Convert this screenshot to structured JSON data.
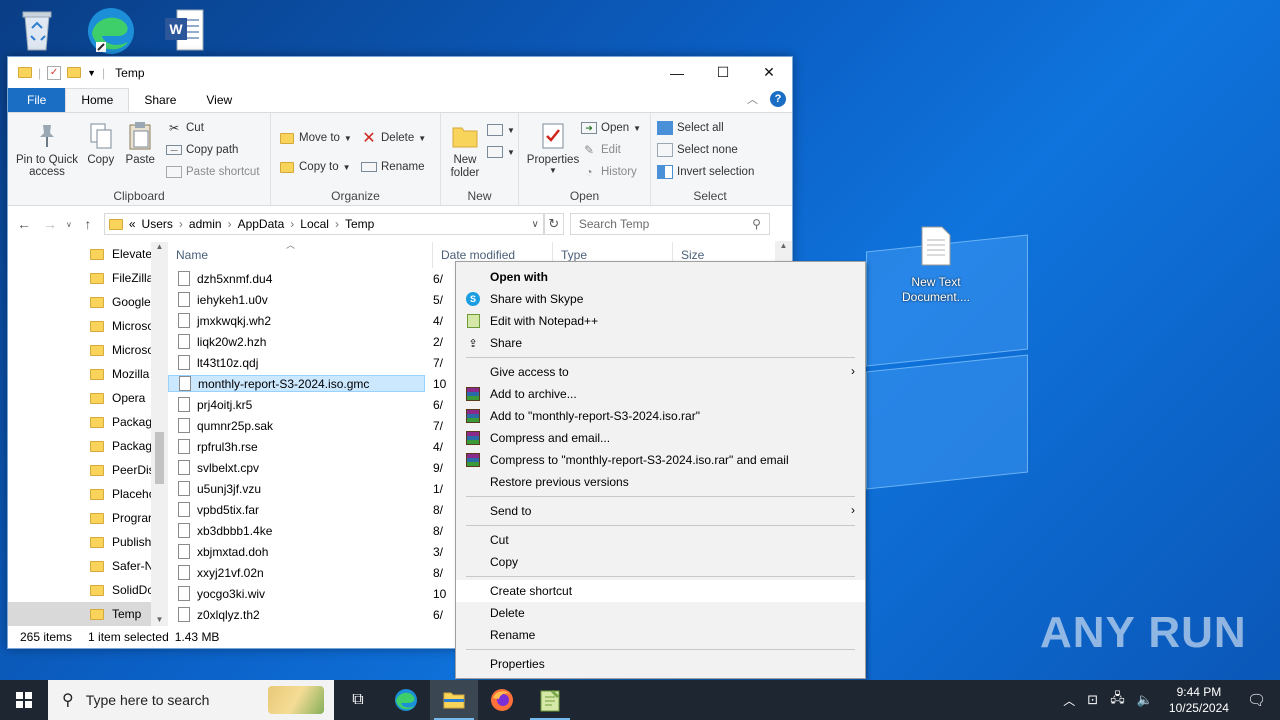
{
  "desktop": {
    "icons": [
      {
        "name": "recycle-bin",
        "label": ""
      },
      {
        "name": "edge",
        "label": ""
      },
      {
        "name": "word",
        "label": ""
      },
      {
        "name": "new-text-document",
        "label": "New Text Document...."
      }
    ],
    "watermark": "ANY RUN"
  },
  "window": {
    "title": "Temp",
    "tabs": [
      "File",
      "Home",
      "Share",
      "View"
    ],
    "ribbon": {
      "clipboard": {
        "pin": "Pin to Quick access",
        "copy": "Copy",
        "paste": "Paste",
        "cut": "Cut",
        "copy_path": "Copy path",
        "paste_shortcut": "Paste shortcut",
        "label": "Clipboard"
      },
      "organize": {
        "move_to": "Move to",
        "copy_to": "Copy to",
        "delete": "Delete",
        "rename": "Rename",
        "label": "Organize"
      },
      "new": {
        "new_folder": "New folder",
        "label": "New"
      },
      "open": {
        "properties": "Properties",
        "open": "Open",
        "edit": "Edit",
        "history": "History",
        "label": "Open"
      },
      "select": {
        "select_all": "Select all",
        "select_none": "Select none",
        "invert": "Invert selection",
        "label": "Select"
      }
    },
    "address": {
      "crumbs": [
        "«",
        "Users",
        "admin",
        "AppData",
        "Local",
        "Temp"
      ],
      "search_placeholder": "Search Temp"
    },
    "nav_items": [
      "Elevate",
      "FileZilla",
      "Google",
      "Microso",
      "Microso",
      "Mozilla",
      "Opera",
      "Packag",
      "Packag",
      "PeerDis",
      "Placeho",
      "Prograr",
      "Publish",
      "Safer-N",
      "SolidDc",
      "Temp"
    ],
    "columns": {
      "name": "Name",
      "date": "Date modified",
      "type": "Type",
      "size": "Size"
    },
    "files": [
      {
        "name": "dzh5xnmf.du4",
        "date": "6/"
      },
      {
        "name": "iehykeh1.u0v",
        "date": "5/"
      },
      {
        "name": "jmxkwqkj.wh2",
        "date": "4/"
      },
      {
        "name": "liqk20w2.hzh",
        "date": "2/"
      },
      {
        "name": "lt43t10z.qdj",
        "date": "7/"
      },
      {
        "name": "monthly-report-S3-2024.iso.gmc",
        "date": "10"
      },
      {
        "name": "prj4oitj.kr5",
        "date": "6/"
      },
      {
        "name": "qumnr25p.sak",
        "date": "7/"
      },
      {
        "name": "rpfrul3h.rse",
        "date": "4/"
      },
      {
        "name": "svlbelxt.cpv",
        "date": "9/"
      },
      {
        "name": "u5unj3jf.vzu",
        "date": "1/"
      },
      {
        "name": "vpbd5tix.far",
        "date": "8/"
      },
      {
        "name": "xb3dbbb1.4ke",
        "date": "8/"
      },
      {
        "name": "xbjmxtad.doh",
        "date": "3/"
      },
      {
        "name": "xxyj21vf.02n",
        "date": "8/"
      },
      {
        "name": "yocgo3ki.wiv",
        "date": "10"
      },
      {
        "name": "z0xlqlyz.th2",
        "date": "6/"
      }
    ],
    "status": {
      "count": "265 items",
      "selected": "1 item selected",
      "size": "1.43 MB"
    }
  },
  "context_menu": {
    "open_with": "Open with",
    "share_skype": "Share with Skype",
    "edit_notepad": "Edit with Notepad++",
    "share": "Share",
    "give_access": "Give access to",
    "add_archive": "Add to archive...",
    "add_rar": "Add to \"monthly-report-S3-2024.iso.rar\"",
    "compress_email": "Compress and email...",
    "compress_rar_email": "Compress to \"monthly-report-S3-2024.iso.rar\" and email",
    "restore": "Restore previous versions",
    "send_to": "Send to",
    "cut": "Cut",
    "copy": "Copy",
    "create_shortcut": "Create shortcut",
    "delete": "Delete",
    "rename": "Rename",
    "properties": "Properties"
  },
  "taskbar": {
    "search_placeholder": "Type here to search",
    "time": "9:44 PM",
    "date": "10/25/2024"
  }
}
